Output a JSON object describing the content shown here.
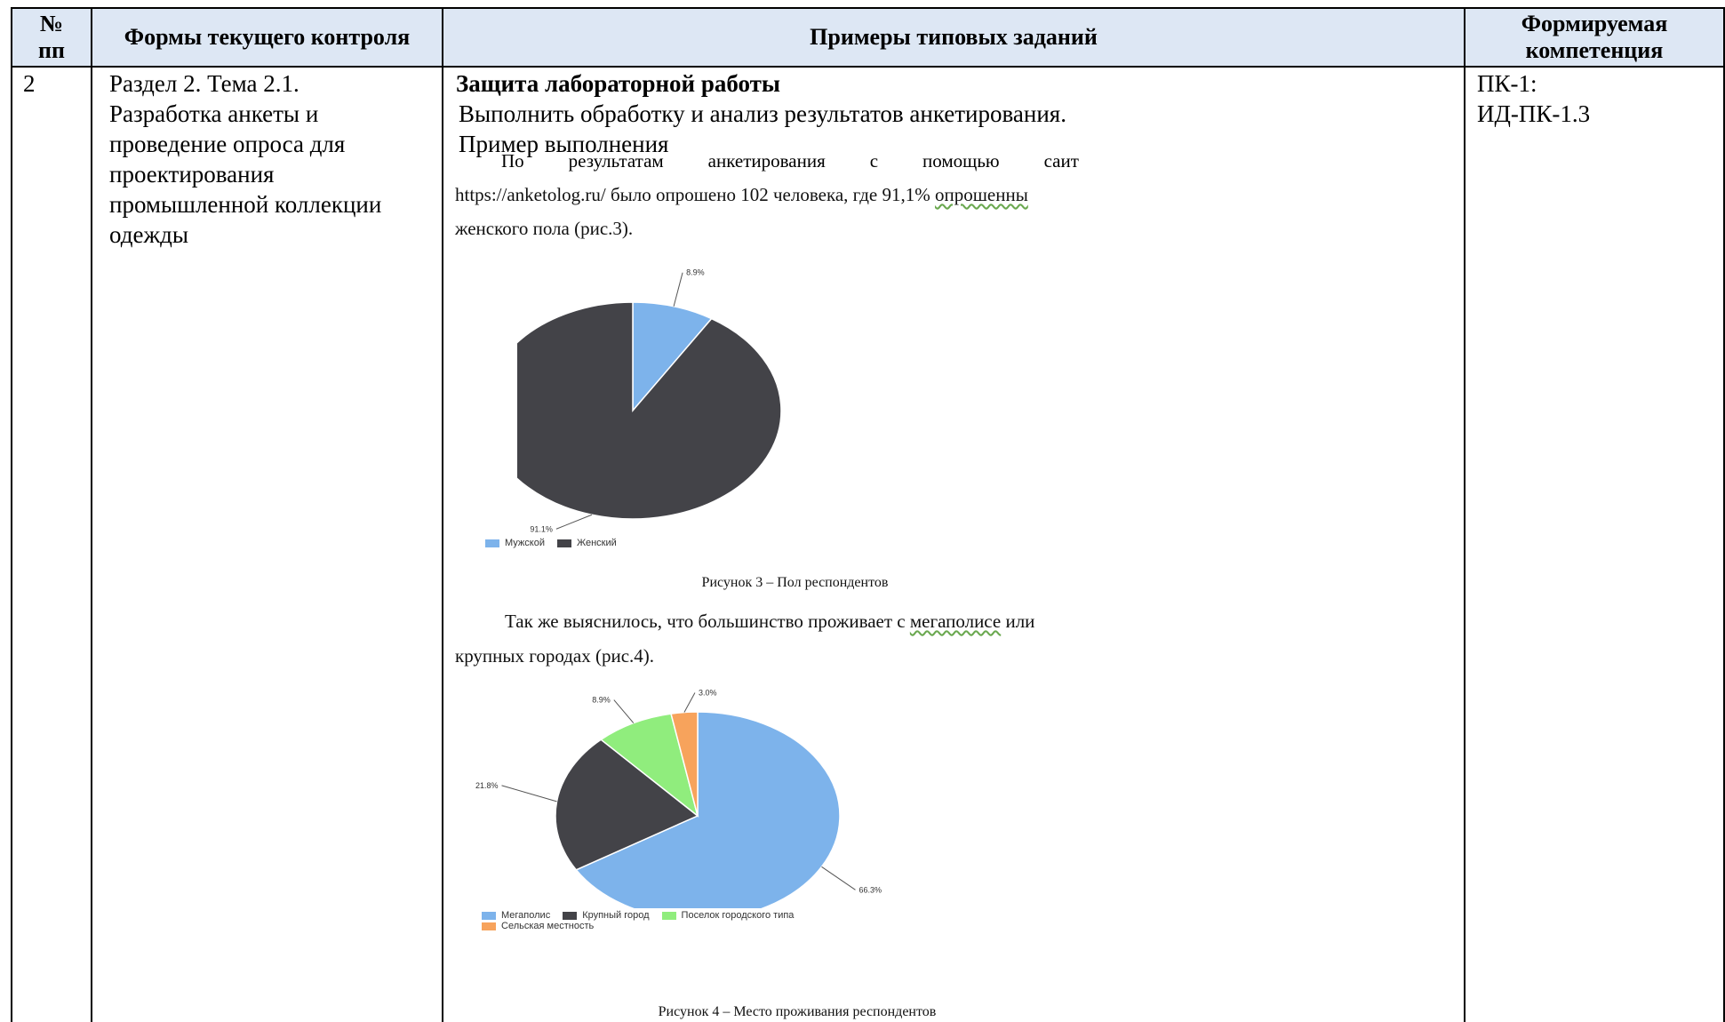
{
  "header": {
    "num": "№\nпп",
    "forms": "Формы текущего контроля",
    "examples": "Примеры типовых заданий",
    "competence": "Формируемая\nкомпетенция"
  },
  "row": {
    "num": "2",
    "form_text": "Раздел 2. Тема 2.1.\nРазработка анкеты и\nпроведение опроса для\nпроектирования\nпромышленной коллекции\nодежды",
    "task_title": "Защита лабораторной работы",
    "task_line": "Выполнить обработку и анализ результатов анкетирования.",
    "example_label": "Пример выполнения",
    "competence": "ПК-1:\nИД-ПК-1.3"
  },
  "figure": {
    "p1_words": [
      "По",
      "результатам",
      "анкетирования",
      "с",
      "помощью",
      "саит"
    ],
    "p1_line2_a": "https://anketolog.ru/ было опрошено 102 человека, где 91,1% ",
    "p1_line2_b": "опрошенны",
    "p1_line3": "женского пола (рис.3).",
    "p2_line1_a": "Так же выяснилось, что большинство проживает с ",
    "p2_line1_b": "мегаполисе",
    "p2_line1_c": " или",
    "p2_line2": "крупных городах (рис.4).",
    "caption3": "Рисунок 3 – Пол респондентов",
    "caption4": "Рисунок 4 – Место проживания респондентов",
    "legend3": [
      "Мужской",
      "Женский"
    ],
    "legend4": [
      "Мегаполис",
      "Крупный город",
      "Поселок городского типа",
      "Сельская местность"
    ]
  },
  "chart_data": [
    {
      "type": "pie",
      "categories": [
        "Мужской",
        "Женский"
      ],
      "values": [
        8.9,
        91.1
      ],
      "labels": [
        "8.9%",
        "91.1%"
      ],
      "colors": [
        "#7db3eb",
        "#434348"
      ]
    },
    {
      "type": "pie",
      "categories": [
        "Мегаполис",
        "Крупный город",
        "Поселок городского типа",
        "Сельская местность"
      ],
      "values": [
        66.3,
        21.8,
        8.9,
        3.0
      ],
      "labels": [
        "66.3%",
        "21.8%",
        "8.9%",
        "3.0%"
      ],
      "colors": [
        "#7db3eb",
        "#434348",
        "#90ed7d",
        "#f7a35c"
      ]
    }
  ]
}
